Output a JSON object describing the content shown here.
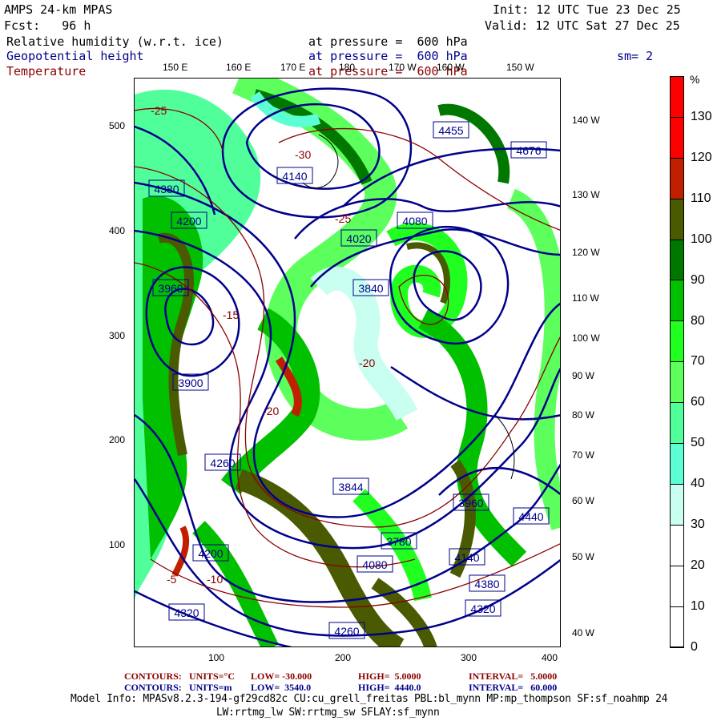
{
  "header": {
    "model": "AMPS 24-km MPAS",
    "forecast": "Fcst:   96 h",
    "init": "Init: 12 UTC Tue 23 Dec 25",
    "valid": "Valid: 12 UTC Sat 27 Dec 25",
    "fields": [
      {
        "name": "Relative humidity (w.r.t. ice)",
        "level": "at pressure =  600 hPa",
        "color": "#000000"
      },
      {
        "name": "Geopotential height",
        "level": "at pressure =  600 hPa",
        "color": "#00008b"
      },
      {
        "name": "Temperature",
        "level": "at pressure =  600 hPa",
        "color": "#8b0000"
      }
    ],
    "smoothing": "sm= 2"
  },
  "axes": {
    "top": [
      "150 E",
      "160 E",
      "170 E",
      "180",
      "170 W",
      "160 W",
      "150 W"
    ],
    "left": [
      "500",
      "400",
      "300",
      "200",
      "100"
    ],
    "bottom": [
      "100",
      "200",
      "300",
      "400"
    ],
    "right": [
      "140 W",
      "130 W",
      "120 W",
      "110 W",
      "100 W",
      "90 W",
      "80 W",
      "70 W",
      "60 W",
      "50 W",
      "40 W"
    ]
  },
  "colorbar": {
    "unit": "%",
    "labels": [
      "130",
      "120",
      "110",
      "100",
      "90",
      "80",
      "70",
      "60",
      "50",
      "40",
      "30",
      "20",
      "10",
      "0"
    ],
    "colors": [
      "#ff0000",
      "#ff0000",
      "#c02000",
      "#4a5a00",
      "#007800",
      "#00c000",
      "#20ff20",
      "#5cff5c",
      "#50ff9a",
      "#5cffd4",
      "#c8fff0",
      "#ffffff",
      "#ffffff",
      "#ffffff"
    ]
  },
  "map": {
    "height_labels": [
      "4455",
      "4676",
      "4140",
      "4380",
      "4020",
      "4080",
      "4200",
      "3960",
      "3840",
      "3900",
      "3844",
      "4260",
      "4320",
      "4440",
      "3780",
      "3960",
      "4080",
      "4320",
      "4380",
      "4200",
      "4140",
      "4260"
    ],
    "temp_labels": [
      "-25",
      "-30",
      "-20",
      "-15",
      "-10",
      "-5",
      "-25",
      "-20"
    ]
  },
  "footer": {
    "temp_contours": {
      "label": "CONTOURS:",
      "units": "UNITS=°C",
      "low": "LOW= -30.000",
      "high": "HIGH=  5.0000",
      "interval": "INTERVAL=   5.0000"
    },
    "height_contours": {
      "label": "CONTOURS:",
      "units": "UNITS=m",
      "low": "LOW=  3540.0",
      "high": "HIGH=  4440.0",
      "interval": "INTERVAL=   60.000"
    },
    "model_info": "Model Info: MPASv8.2.3-194-gf29cd82c CU:cu_grell_freitas PBL:bl_mynn MP:mp_thompson SF:sf_noahmp 24",
    "model_info2": "LW:rrtmg_lw SW:rrtmg_sw SFLAY:sf_mynn"
  }
}
